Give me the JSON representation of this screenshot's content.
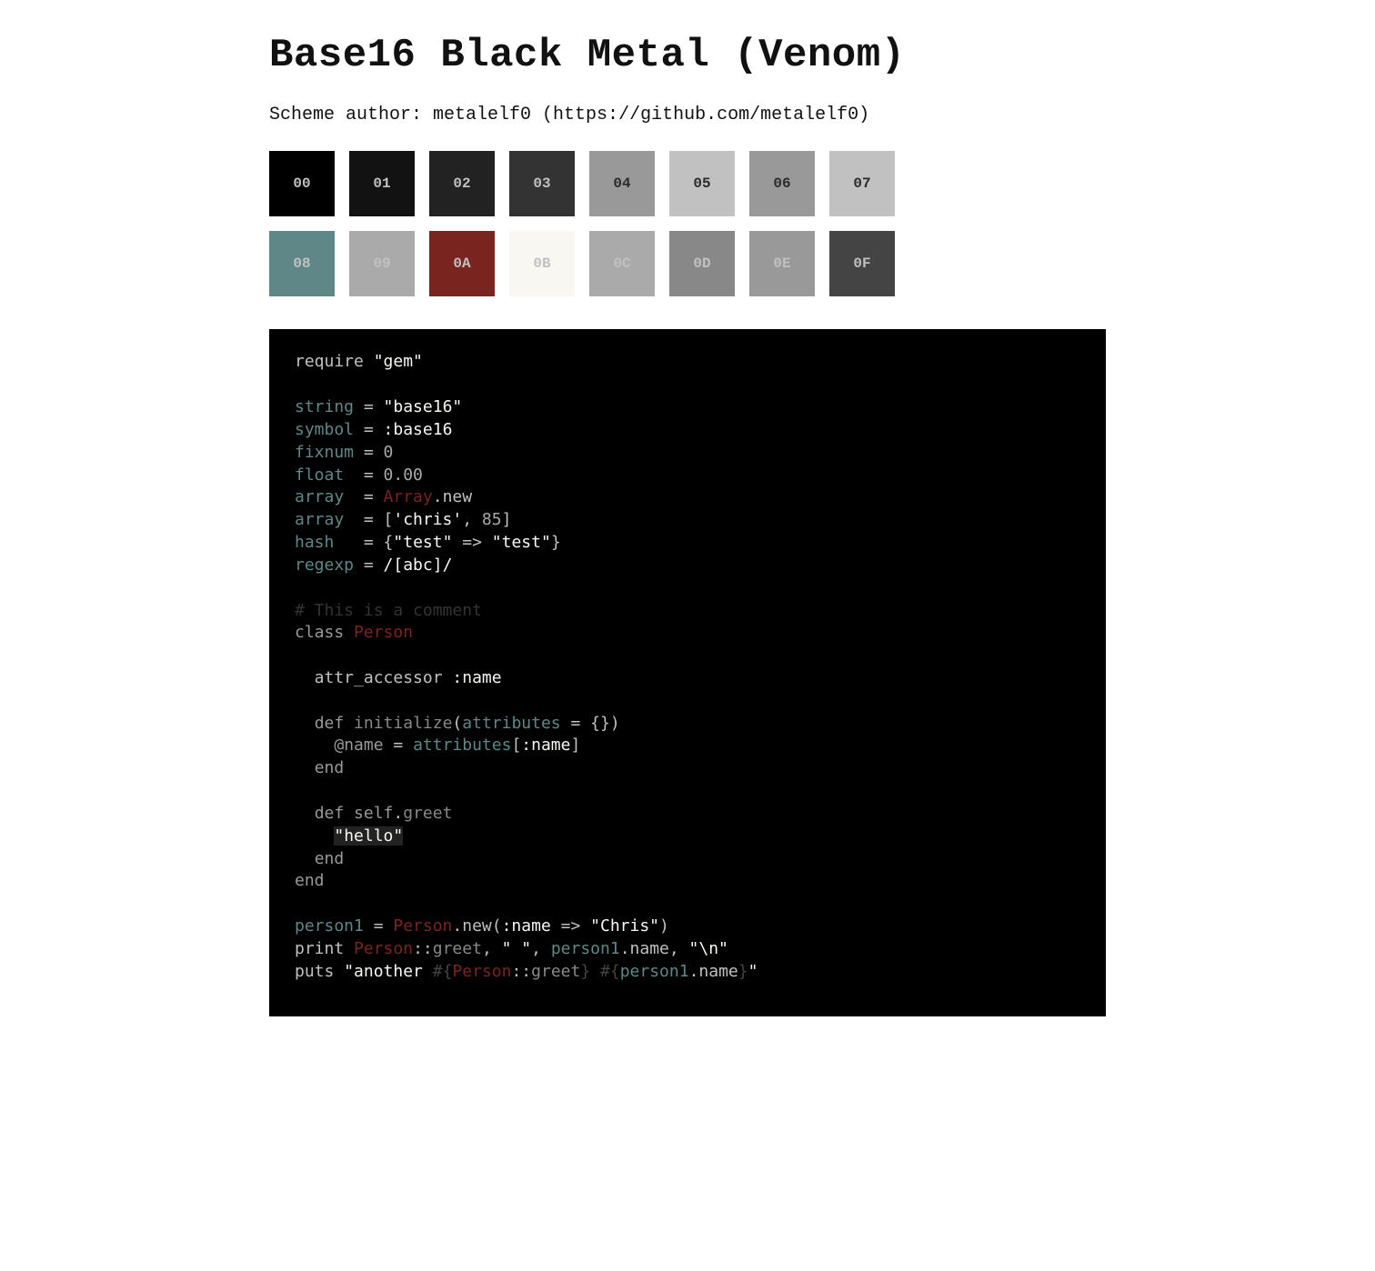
{
  "title": "Base16 Black Metal (Venom)",
  "author_line": "Scheme author: metalelf0 (https://github.com/metalelf0)",
  "palette": [
    {
      "id": "00",
      "hex": "#000000",
      "label_color": "#c1c1c1"
    },
    {
      "id": "01",
      "hex": "#121212",
      "label_color": "#c1c1c1"
    },
    {
      "id": "02",
      "hex": "#222222",
      "label_color": "#c1c1c1"
    },
    {
      "id": "03",
      "hex": "#333333",
      "label_color": "#c1c1c1"
    },
    {
      "id": "04",
      "hex": "#999999",
      "label_color": "#2b2b2b"
    },
    {
      "id": "05",
      "hex": "#c1c1c1",
      "label_color": "#2b2b2b"
    },
    {
      "id": "06",
      "hex": "#999999",
      "label_color": "#2b2b2b"
    },
    {
      "id": "07",
      "hex": "#c1c1c1",
      "label_color": "#2b2b2b"
    },
    {
      "id": "08",
      "hex": "#5f8787",
      "label_color": "#c1c1c1"
    },
    {
      "id": "09",
      "hex": "#aaaaaa",
      "label_color": "#c1c1c1"
    },
    {
      "id": "0A",
      "hex": "#79241f",
      "label_color": "#c1c1c1"
    },
    {
      "id": "0B",
      "hex": "#f8f7f2",
      "label_color": "#c1c1c1"
    },
    {
      "id": "0C",
      "hex": "#aaaaaa",
      "label_color": "#c1c1c1"
    },
    {
      "id": "0D",
      "hex": "#888888",
      "label_color": "#c1c1c1"
    },
    {
      "id": "0E",
      "hex": "#999999",
      "label_color": "#c1c1c1"
    },
    {
      "id": "0F",
      "hex": "#444444",
      "label_color": "#c1c1c1"
    }
  ],
  "swatch_rows": [
    [
      "00",
      "01",
      "02",
      "03",
      "04",
      "05",
      "06",
      "07"
    ],
    [
      "08",
      "09",
      "0A",
      "0B",
      "0C",
      "0D",
      "0E",
      "0F"
    ]
  ],
  "code_tokens": [
    [
      "base05",
      "require "
    ],
    [
      "base0B",
      "\"gem\""
    ],
    [
      "nl",
      ""
    ],
    [
      "nl",
      ""
    ],
    [
      "base08",
      "string"
    ],
    [
      "base05",
      " = "
    ],
    [
      "base0B",
      "\"base16\""
    ],
    [
      "nl",
      ""
    ],
    [
      "base08",
      "symbol"
    ],
    [
      "base05",
      " = "
    ],
    [
      "base0B",
      ":base16"
    ],
    [
      "nl",
      ""
    ],
    [
      "base08",
      "fixnum"
    ],
    [
      "base05",
      " = "
    ],
    [
      "base09",
      "0"
    ],
    [
      "nl",
      ""
    ],
    [
      "base08",
      "float"
    ],
    [
      "base05",
      "  = "
    ],
    [
      "base09",
      "0.00"
    ],
    [
      "nl",
      ""
    ],
    [
      "base08",
      "array"
    ],
    [
      "base05",
      "  = "
    ],
    [
      "base0A",
      "Array"
    ],
    [
      "base05",
      ".new"
    ],
    [
      "nl",
      ""
    ],
    [
      "base08",
      "array"
    ],
    [
      "base05",
      "  = ["
    ],
    [
      "base0B",
      "'chris'"
    ],
    [
      "base05",
      ", "
    ],
    [
      "base09",
      "85"
    ],
    [
      "base05",
      "]"
    ],
    [
      "nl",
      ""
    ],
    [
      "base08",
      "hash"
    ],
    [
      "base05",
      "   = {"
    ],
    [
      "base0B",
      "\"test\""
    ],
    [
      "base05",
      " => "
    ],
    [
      "base0B",
      "\"test\""
    ],
    [
      "base05",
      "}"
    ],
    [
      "nl",
      ""
    ],
    [
      "base08",
      "regexp"
    ],
    [
      "base05",
      " = "
    ],
    [
      "base0B",
      "/[abc]/"
    ],
    [
      "nl",
      ""
    ],
    [
      "nl",
      ""
    ],
    [
      "base03",
      "# This is a comment"
    ],
    [
      "nl",
      ""
    ],
    [
      "base0E",
      "class"
    ],
    [
      "base05",
      " "
    ],
    [
      "base0A",
      "Person"
    ],
    [
      "nl",
      ""
    ],
    [
      "nl",
      ""
    ],
    [
      "base05",
      "  attr_accessor "
    ],
    [
      "base0B",
      ":name"
    ],
    [
      "nl",
      ""
    ],
    [
      "nl",
      ""
    ],
    [
      "base05",
      "  "
    ],
    [
      "base0E",
      "def"
    ],
    [
      "base05",
      " "
    ],
    [
      "base0D",
      "initialize"
    ],
    [
      "base05",
      "("
    ],
    [
      "base08",
      "attributes"
    ],
    [
      "base05",
      " = {})"
    ],
    [
      "nl",
      ""
    ],
    [
      "base05",
      "    "
    ],
    [
      "base0E",
      "@name"
    ],
    [
      "base05",
      " = "
    ],
    [
      "base08",
      "attributes"
    ],
    [
      "base05",
      "["
    ],
    [
      "base0B",
      ":name"
    ],
    [
      "base05",
      "]"
    ],
    [
      "nl",
      ""
    ],
    [
      "base05",
      "  "
    ],
    [
      "base0E",
      "end"
    ],
    [
      "nl",
      ""
    ],
    [
      "nl",
      ""
    ],
    [
      "base05",
      "  "
    ],
    [
      "base0E",
      "def"
    ],
    [
      "base05",
      " "
    ],
    [
      "base0E",
      "self"
    ],
    [
      "base05",
      "."
    ],
    [
      "base0D",
      "greet"
    ],
    [
      "nl",
      ""
    ],
    [
      "base05",
      "    "
    ],
    [
      "sel_base0B",
      "\"hello\""
    ],
    [
      "nl",
      ""
    ],
    [
      "base05",
      "  "
    ],
    [
      "base0E",
      "end"
    ],
    [
      "nl",
      ""
    ],
    [
      "base0E",
      "end"
    ],
    [
      "nl",
      ""
    ],
    [
      "nl",
      ""
    ],
    [
      "base08",
      "person1"
    ],
    [
      "base05",
      " = "
    ],
    [
      "base0A",
      "Person"
    ],
    [
      "base05",
      ".new("
    ],
    [
      "base0B",
      ":name"
    ],
    [
      "base05",
      " => "
    ],
    [
      "base0B",
      "\"Chris\""
    ],
    [
      "base05",
      ")"
    ],
    [
      "nl",
      ""
    ],
    [
      "base05",
      "print "
    ],
    [
      "base0A",
      "Person"
    ],
    [
      "base05",
      "::"
    ],
    [
      "base0D",
      "greet"
    ],
    [
      "base05",
      ", "
    ],
    [
      "base0B",
      "\" \""
    ],
    [
      "base05",
      ", "
    ],
    [
      "base08",
      "person1"
    ],
    [
      "base05",
      ".name, "
    ],
    [
      "base0B",
      "\"\\n\""
    ],
    [
      "nl",
      ""
    ],
    [
      "base05",
      "puts "
    ],
    [
      "base0B",
      "\"another "
    ],
    [
      "base0F",
      "#{"
    ],
    [
      "base0A",
      "Person"
    ],
    [
      "base05",
      "::"
    ],
    [
      "base0D",
      "greet"
    ],
    [
      "base0F",
      "}"
    ],
    [
      "base0B",
      " "
    ],
    [
      "base0F",
      "#{"
    ],
    [
      "base08",
      "person1"
    ],
    [
      "base05",
      ".name"
    ],
    [
      "base0F",
      "}"
    ],
    [
      "base0B",
      "\""
    ],
    [
      "nl",
      ""
    ]
  ]
}
